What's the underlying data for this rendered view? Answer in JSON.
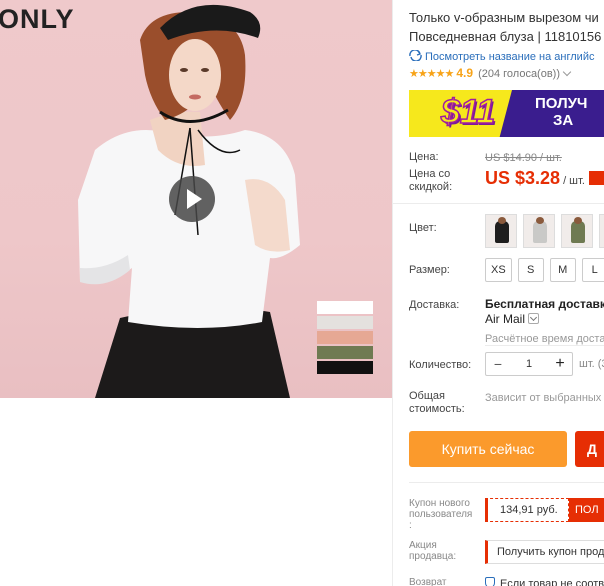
{
  "gallery": {
    "brand": "ONLY",
    "swatch_colors": [
      "#ffffff",
      "#e4e1de",
      "#e6a894",
      "#6f7a52",
      "#111111"
    ]
  },
  "product": {
    "title_line1": "Только v-образным вырезом чи",
    "title_line2": "Повседневная блуза | 11810156",
    "translate_link": "Посмотреть название на английс",
    "rating_stars": "★★★★★",
    "rating_score": "4.9",
    "rating_votes": "(204 голоса(ов))"
  },
  "banner": {
    "price": "$11",
    "text_line1": "ПОЛУЧ",
    "text_line2": "ЗА"
  },
  "pricing": {
    "price_label": "Цена:",
    "old_price": "US $14.90 / шт.",
    "discount_label_1": "Цена со",
    "discount_label_2": "скидкой:",
    "new_price": "US $3.28",
    "unit": "/ шт."
  },
  "options": {
    "color_label": "Цвет:",
    "color_thumbs": [
      {
        "name": "black",
        "color": "#1e1e1e"
      },
      {
        "name": "gray",
        "color": "#c9c9c7"
      },
      {
        "name": "green",
        "color": "#6f7a52"
      },
      {
        "name": "white",
        "color": "#f7f7f7"
      }
    ],
    "size_label": "Размер:",
    "sizes": [
      "XS",
      "S",
      "M",
      "L"
    ]
  },
  "shipping": {
    "label": "Доставка:",
    "free": "Бесплатная доставка в",
    "method": "Air Mail",
    "eta": "Расчётное время доставк"
  },
  "quantity": {
    "label": "Количество:",
    "value": "1",
    "minus": "−",
    "plus": "+",
    "note": "шт. (3"
  },
  "total": {
    "label_1": "Общая",
    "label_2": "стоимость:",
    "value": "Зависит от выбранных з"
  },
  "actions": {
    "buy_now": "Купить сейчас",
    "add_to_cart": "Д"
  },
  "coupons": {
    "new_user_label_1": "Купон нового",
    "new_user_label_2": "пользователя",
    "new_user_label_3": ":",
    "coupon_value": "134,91 руб.",
    "coupon_button": "ПОЛ",
    "seller_label_1": "Акция",
    "seller_label_2": "продавца:",
    "seller_promo": "Получить купон прод",
    "return_label": "Возврат",
    "return_text": "Если товар не соотве"
  }
}
